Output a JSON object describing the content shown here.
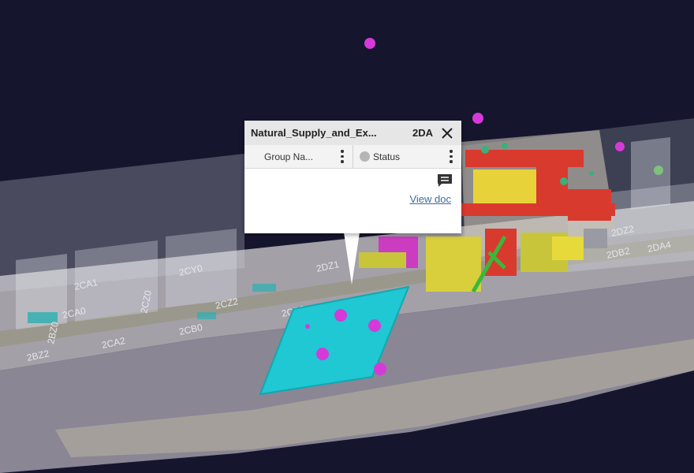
{
  "popup": {
    "title": "Natural_Supply_and_Ex...",
    "code": "2DA",
    "columns": [
      {
        "label": "Group Na..."
      },
      {
        "label": "Status"
      }
    ],
    "link": "View doc"
  },
  "scene": {
    "zone_labels": [
      "2CA1",
      "2CA0",
      "2BZ0",
      "2BZ2",
      "2CA2",
      "2CB0",
      "2CB2",
      "2CY0",
      "2CZ0",
      "2CZ2",
      "2DZ1",
      "2DB2",
      "2DA4",
      "2DZ2"
    ]
  },
  "colors": {
    "background": "#15152e",
    "selection": "#1fc8d2",
    "marker": "#d53ad8",
    "hull": "#8f8b98"
  }
}
